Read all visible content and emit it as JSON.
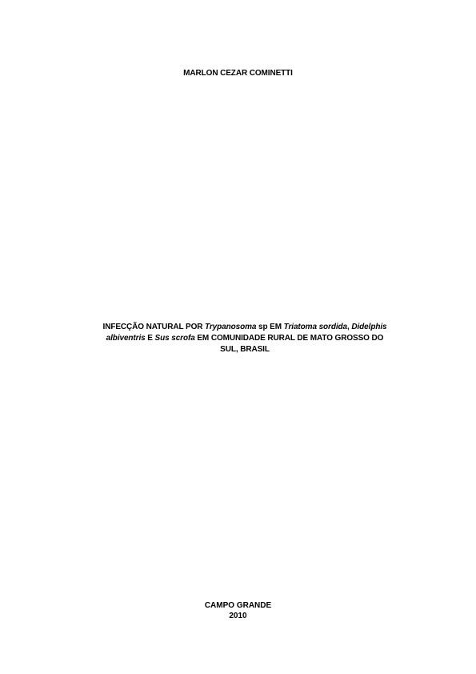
{
  "author": "MARLON CEZAR COMINETTI",
  "title": {
    "line1": {
      "t1": "INFECÇÃO NATURAL POR ",
      "i1": "Trypanosoma",
      "t2": " sp EM ",
      "i2": "Triatoma sordida",
      "t3": ", ",
      "i3": "Didelphis"
    },
    "line2": {
      "i1": "albiventris",
      "t1": " E ",
      "i2": "Sus scrofa",
      "t2": " EM COMUNIDADE RURAL DE MATO GROSSO DO"
    },
    "line3": "SUL, BRASIL"
  },
  "footer": {
    "city": "CAMPO GRANDE",
    "year": "2010"
  }
}
